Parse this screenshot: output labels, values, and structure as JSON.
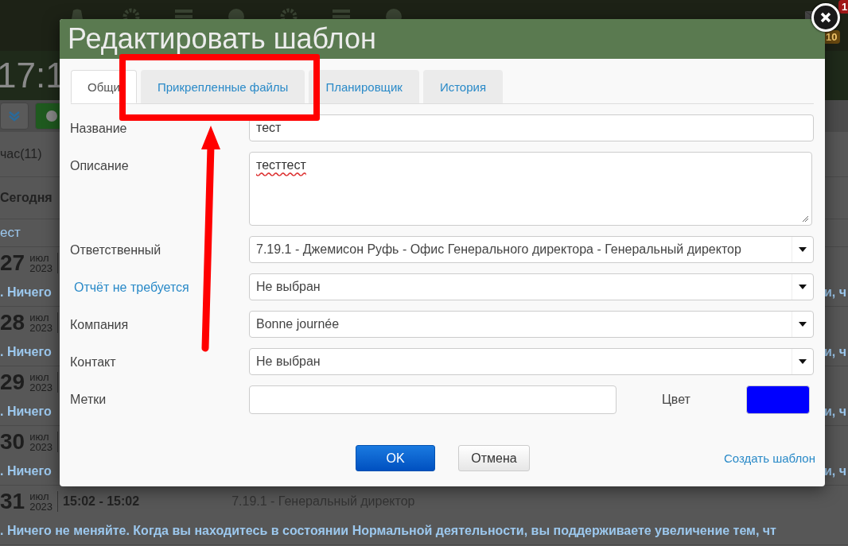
{
  "background": {
    "time": "17:1",
    "badges": [
      {
        "text": "1",
        "kind": "alert"
      },
      {
        "text": "10",
        "kind": "count"
      }
    ],
    "filter_tab": "час(11)",
    "day_header": "Сегодня",
    "task_title": "ест",
    "records": [
      {
        "day": "27",
        "month": "июл",
        "year": "2023",
        "text_left": ". Ничего",
        "text_right": "и, ч"
      },
      {
        "day": "28",
        "month": "июл",
        "year": "2023",
        "text_left": ". Ничего",
        "text_right": "и, ч"
      },
      {
        "day": "29",
        "month": "июл",
        "year": "2023",
        "text_left": ". Ничего",
        "text_right": "и, ч"
      },
      {
        "day": "30",
        "month": "июл",
        "year": "2023",
        "text_left": ". Ничего",
        "text_right": "и, ч"
      },
      {
        "day": "31",
        "month": "июл",
        "year": "2023",
        "time": "15:02 - 15:02",
        "employee": "7.19.1 - Генеральный директор",
        "text": ". Ничего не меняйте. Когда вы находитесь в состоянии Нормальной деятельности, вы поддерживаете увеличение тем, чт"
      }
    ]
  },
  "dialog": {
    "title": "Редактировать шаблон",
    "tabs": [
      {
        "label": "Общи",
        "selected": true
      },
      {
        "label": "Прикрепленные файлы",
        "selected": false
      },
      {
        "label": "Планировщик",
        "selected": false
      },
      {
        "label": "История",
        "selected": false
      }
    ],
    "fields": [
      {
        "kind": "text",
        "label": "Название",
        "link": false,
        "value": "тест"
      },
      {
        "kind": "textarea",
        "label": "Описание",
        "link": false,
        "value": "тесттест"
      },
      {
        "kind": "select",
        "label": "Ответственный",
        "link": false,
        "value": "7.19.1 - Джемисон Руфь - Офис Генерального директора - Генеральный директор"
      },
      {
        "kind": "select",
        "label": "Отчёт не требуется",
        "link": true,
        "value": "Не выбран"
      },
      {
        "kind": "select",
        "label": "Компания",
        "link": false,
        "value": "Bonne journée"
      },
      {
        "kind": "select",
        "label": "Контакт",
        "link": false,
        "value": "Не выбран"
      },
      {
        "kind": "tags",
        "label": "Метки",
        "link": false,
        "color_label": "Цвет",
        "color": "#0000ff"
      }
    ],
    "buttons": [
      {
        "label": "OK",
        "kind": "primary"
      },
      {
        "label": "Отмена",
        "kind": "default"
      }
    ],
    "create_link": "Создать шаблон"
  }
}
